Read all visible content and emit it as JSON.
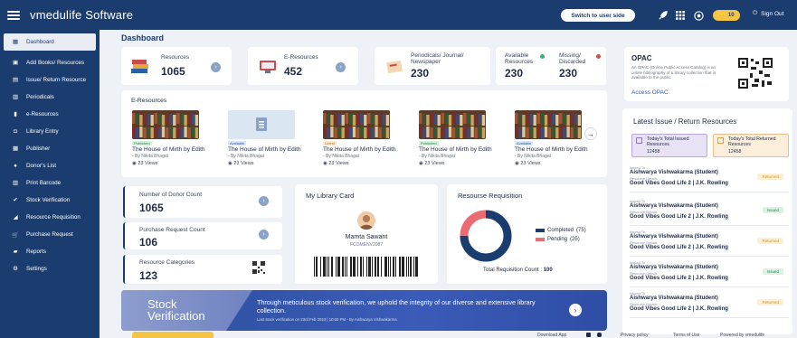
{
  "header": {
    "brand": "vmedulife Software",
    "switch_label": "Switch to user side",
    "coin_count": "10",
    "signout": "Sign Out"
  },
  "sidebar": {
    "items": [
      {
        "label": "Dashboard",
        "icon": "dashboard-icon"
      },
      {
        "label": "Add Books/ Resources",
        "icon": "add-book-icon"
      },
      {
        "label": "Issue/ Return Resource",
        "icon": "issue-return-icon"
      },
      {
        "label": "Periodicals",
        "icon": "periodicals-icon"
      },
      {
        "label": "e-Resources",
        "icon": "e-resources-icon"
      },
      {
        "label": "Library Entry",
        "icon": "library-entry-icon"
      },
      {
        "label": "Publisher",
        "icon": "publisher-icon"
      },
      {
        "label": "Donor's List",
        "icon": "donor-icon"
      },
      {
        "label": "Print Barcode",
        "icon": "barcode-icon"
      },
      {
        "label": "Stock Verification",
        "icon": "stock-icon"
      },
      {
        "label": "Resource Requisition",
        "icon": "requisition-icon"
      },
      {
        "label": "Purchase Request",
        "icon": "cart-icon"
      },
      {
        "label": "Reports",
        "icon": "reports-icon"
      },
      {
        "label": "Settings",
        "icon": "settings-icon"
      }
    ]
  },
  "dashboard": {
    "title": "Dashboard"
  },
  "stats": {
    "resources": {
      "label": "Resources",
      "value": "1065"
    },
    "eresources": {
      "label": "E-Resources",
      "value": "452"
    },
    "periodicals": {
      "label": "Periodicals/ Journal/ Newspaper",
      "value": "230"
    },
    "available": {
      "label": "Available Resources",
      "value": "230"
    },
    "missing": {
      "label": "Missing/ Discarded",
      "value": "230"
    }
  },
  "opac": {
    "title": "OPAC",
    "desc": "An OPAC (Online Public Access Catalog) is an online bibliography of a library collection that is available to the public.",
    "link": "Access OPAC"
  },
  "eres": {
    "title": "E-Resources",
    "items": [
      {
        "tag": "Published",
        "title": "The House of Mirth by Edith",
        "by": "- By Nikita Bhagat",
        "views": "23 Views"
      },
      {
        "tag": "Available",
        "title": "The House of Mirth by Edith",
        "by": "- By Nikita Bhagat",
        "views": "23 Views"
      },
      {
        "tag": "Latest",
        "title": "The House of Mirth by Edith",
        "by": "- By Nikita Bhagat",
        "views": "23 Views"
      },
      {
        "tag": "Published",
        "title": "The House of Mirth by Edith",
        "by": "- By Nikita Bhagat",
        "views": "23 Views"
      },
      {
        "tag": "Available",
        "title": "The House of Mirth by Edith",
        "by": "- By Nikita Bhagat",
        "views": "23 Views"
      }
    ]
  },
  "donor": {
    "donor_count": {
      "label": "Number of Donor Count",
      "value": "1065"
    },
    "purchase": {
      "label": "Purchase Request Count",
      "value": "106"
    },
    "categories": {
      "label": "Resource Categories",
      "value": "123"
    }
  },
  "card": {
    "title": "My Library Card",
    "name": "Mamta Sawant",
    "id": "FCOMENV2087"
  },
  "requisition": {
    "title": "Resourse Requisition",
    "completed_label": "Completed",
    "completed": 75,
    "pending_label": "Pending",
    "pending": 25,
    "total_label": "Total Requisition Count :",
    "total": "100",
    "completed_color": "#1b3c6e",
    "pending_color": "#ec6b73"
  },
  "banner": {
    "title1": "Stock",
    "title2": "Verification",
    "text": "Through meticulous stock verification, we uphold the integrity of our diverse and extensive library collection.",
    "sub": "Last stock verification on 23rd Feb 2023 | 10:00 PM - By Aishwarya Vishwakarma"
  },
  "latest": {
    "title": "Latest Issue / Return Resources",
    "issued_label": "Today's Total Issued Resources",
    "issued": "12458",
    "returned_label": "Today's Total Returned Resources",
    "returned": "12458",
    "rows": [
      {
        "k1": "Issued To",
        "name": "Aishwarya Vishwakarma (Student)",
        "k2": "Resource Details",
        "book": "Good Vibes Good Life 2 | J.K. Rowling",
        "status": "Returned"
      },
      {
        "k1": "Issued To",
        "name": "Aishwarya Vishwakarma (Student)",
        "k2": "Resource Details",
        "book": "Good Vibes Good Life 2 | J.K. Rowling",
        "status": "Issued"
      },
      {
        "k1": "Issued To",
        "name": "Aishwarya Vishwakarma (Student)",
        "k2": "Resource Details",
        "book": "Good Vibes Good Life 2 | J.K. Rowling",
        "status": "Returned"
      },
      {
        "k1": "Issued To",
        "name": "Aishwarya Vishwakarma (Student)",
        "k2": "Resource Details",
        "book": "Good Vibes Good Life 2 | J.K. Rowling",
        "status": "Issued"
      },
      {
        "k1": "Issued To",
        "name": "Aishwarya Vishwakarma (Student)",
        "k2": "Resource Details",
        "book": "Good Vibes Good Life 2 | J.K. Rowling",
        "status": "Returned"
      }
    ]
  },
  "footer": {
    "download": "Download App",
    "privacy": "Privacy policy",
    "terms": "Terms of Use",
    "powered": "Powered by vmedulife"
  }
}
